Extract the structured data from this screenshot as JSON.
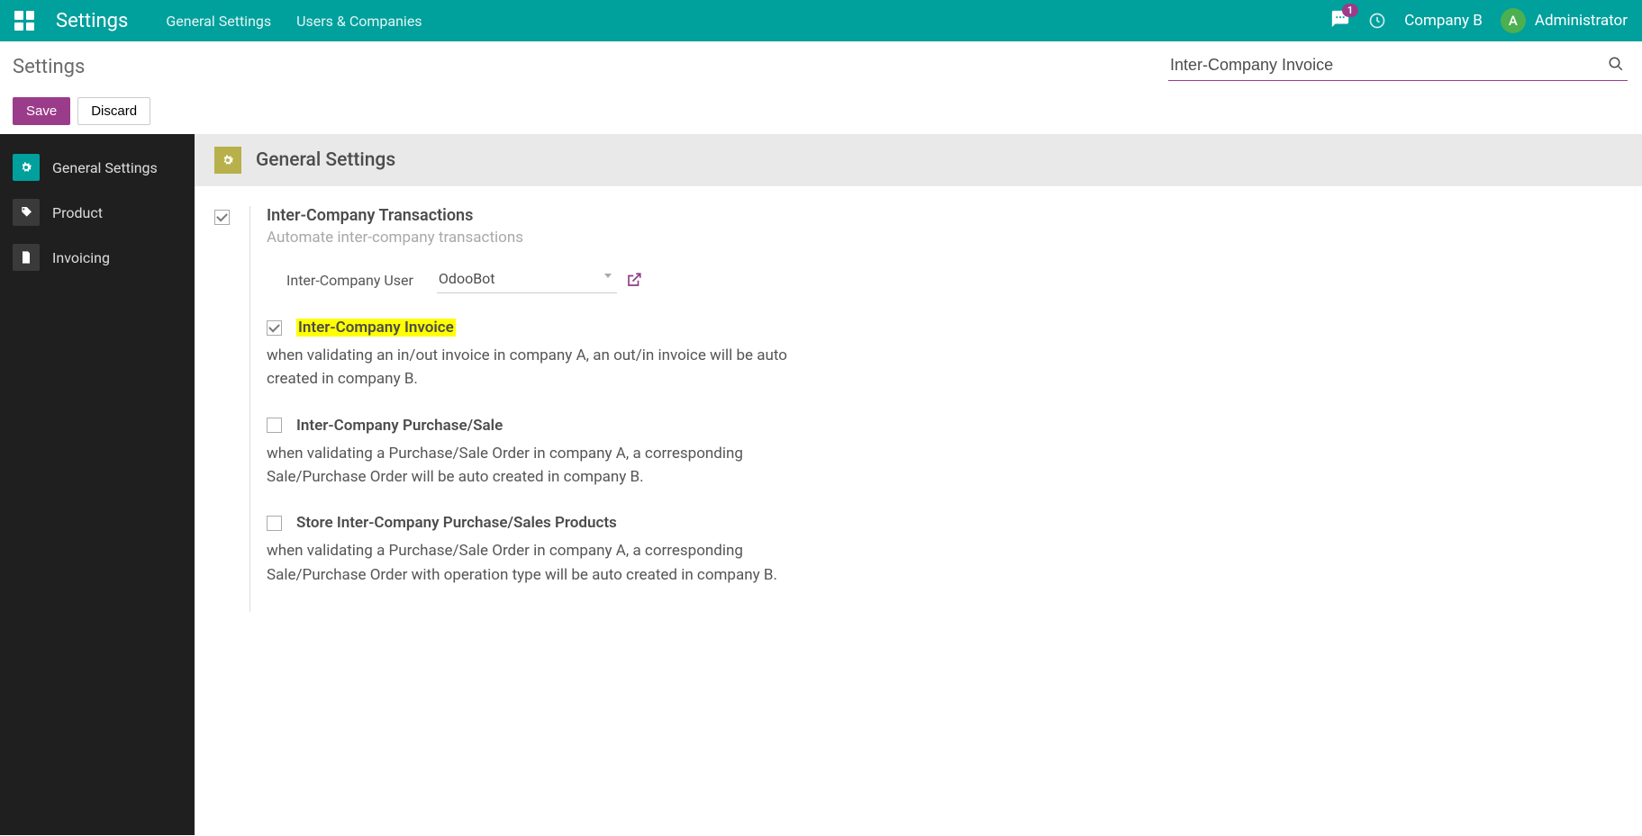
{
  "navbar": {
    "app_title": "Settings",
    "menu": [
      "General Settings",
      "Users & Companies"
    ],
    "badge_count": "1",
    "company": "Company B",
    "avatar_initial": "A",
    "user_name": "Administrator"
  },
  "control_panel": {
    "title": "Settings",
    "search_value": "Inter-Company Invoice",
    "save_label": "Save",
    "discard_label": "Discard"
  },
  "sidebar": {
    "items": [
      {
        "label": "General Settings"
      },
      {
        "label": "Product"
      },
      {
        "label": "Invoicing"
      }
    ]
  },
  "section": {
    "title": "General Settings",
    "setting": {
      "title": "Inter-Company Transactions",
      "subtitle": "Automate inter-company transactions",
      "user_field_label": "Inter-Company User",
      "user_value": "OdooBot",
      "options": [
        {
          "label": "Inter-Company Invoice",
          "desc": "when validating an in/out invoice in company A, an out/in invoice will be auto created in company B.",
          "checked": true,
          "highlight": true
        },
        {
          "label": "Inter-Company Purchase/Sale",
          "desc": "when validating a Purchase/Sale Order in company A, a corresponding Sale/Purchase Order will be auto created in company B.",
          "checked": false,
          "highlight": false
        },
        {
          "label": "Store Inter-Company Purchase/Sales Products",
          "desc": "when validating a Purchase/Sale Order in company A, a corresponding Sale/Purchase Order with operation type will be auto created in company B.",
          "checked": false,
          "highlight": false
        }
      ]
    }
  }
}
